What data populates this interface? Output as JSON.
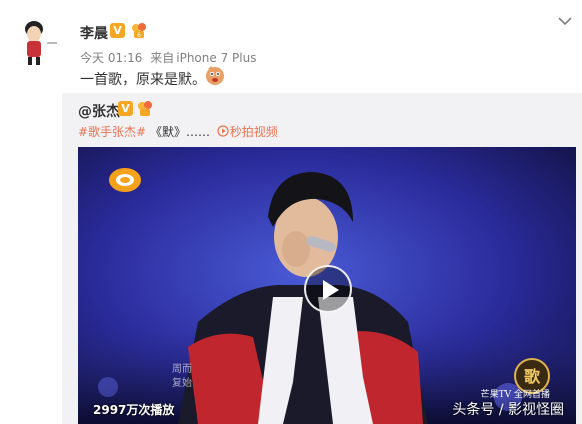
{
  "post": {
    "author": "李晨",
    "verified_badge": "V",
    "time": "今天 01:16",
    "source_prefix": "来自",
    "device": "iPhone 7 Plus",
    "text": "一首歌，原来是默。"
  },
  "repost": {
    "original_author": "@张杰",
    "verified_badge": "V",
    "tag": "#歌手张杰#",
    "text": " 《默》……",
    "video_link": "秒拍视频"
  },
  "video": {
    "play_count": "2997万次播放",
    "caption_line1": "周而",
    "caption_line2": "复始",
    "show_caption": "芒果TV 全网首播",
    "watermark": "头条号 / 影视怪圈"
  },
  "colors": {
    "link": "#eb7350",
    "verified": "#f5a623",
    "repost_bg": "#f2f2f5",
    "meta_text": "#808080"
  },
  "icons": [
    "chevron-down-icon",
    "play-icon",
    "video-link-icon",
    "vip-badge-icon",
    "emoji-icon"
  ]
}
